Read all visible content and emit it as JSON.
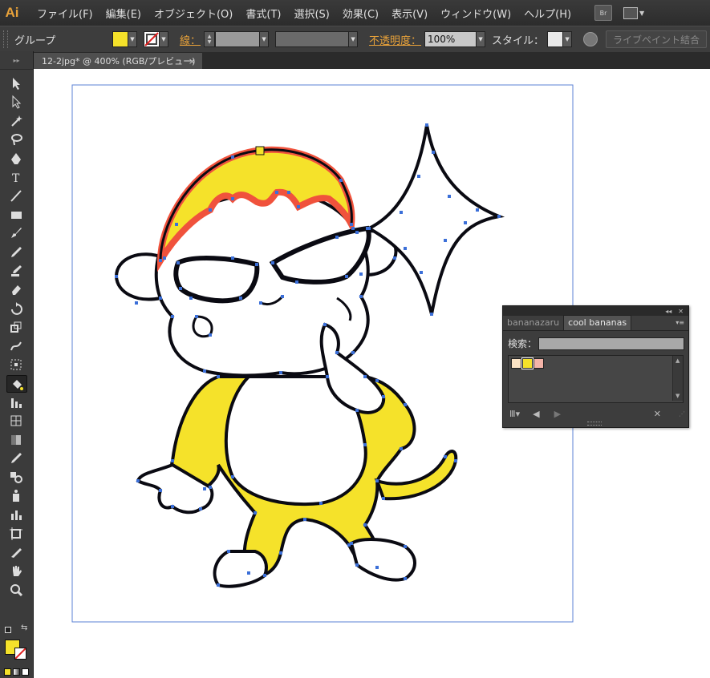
{
  "app": {
    "logo": "Ai"
  },
  "menu": [
    "ファイル(F)",
    "編集(E)",
    "オブジェクト(O)",
    "書式(T)",
    "選択(S)",
    "効果(C)",
    "表示(V)",
    "ウィンドウ(W)",
    "ヘルプ(H)"
  ],
  "menu_right": {
    "bridge_label": "Br",
    "workspace_icon": "workspace-layout-icon"
  },
  "control": {
    "selection_label": "グループ",
    "fill_color": "#f5e22a",
    "stroke_icon": "no-stroke-icon",
    "stroke_label": "線：",
    "opacity_label": "不透明度：",
    "opacity_value": "100%",
    "style_label": "スタイル：",
    "live_paint_label": "ライブペイント結合"
  },
  "document_tab": {
    "title": "12-2jpg* @ 400% (RGB/プレビュー)",
    "close": "×"
  },
  "tools": [
    "selection-tool-icon",
    "direct-selection-tool-icon",
    "magic-wand-tool-icon",
    "lasso-tool-icon",
    "pen-tool-icon",
    "type-tool-icon",
    "line-tool-icon",
    "rectangle-tool-icon",
    "paintbrush-tool-icon",
    "pencil-tool-icon",
    "blob-brush-tool-icon",
    "eraser-tool-icon",
    "rotate-tool-icon",
    "scale-tool-icon",
    "warp-tool-icon",
    "free-transform-tool-icon",
    "live-paint-bucket-tool-icon",
    "graph-tool-icon",
    "mesh-tool-icon",
    "gradient-tool-icon",
    "eyedropper-tool-icon",
    "blend-tool-icon",
    "symbol-sprayer-tool-icon",
    "column-graph-tool-icon",
    "artboard-tool-icon",
    "slice-tool-icon",
    "hand-tool-icon",
    "zoom-tool-icon"
  ],
  "tool_colors": {
    "fill": "#f5e22a",
    "stroke": "none"
  },
  "swatch_panel": {
    "tabs": [
      "bananazaru",
      "cool bananas"
    ],
    "active_tab": "cool bananas",
    "search_label": "検索：",
    "search_value": "",
    "swatches": [
      "#fbe3c4",
      "#f5e22a",
      "#f4b4a8"
    ],
    "selected_swatch": 1
  },
  "colors": {
    "accent": "#e8a23a",
    "selection": "#3b6fd8",
    "yellow": "#f5e22a",
    "red_orange": "#f0523c"
  }
}
